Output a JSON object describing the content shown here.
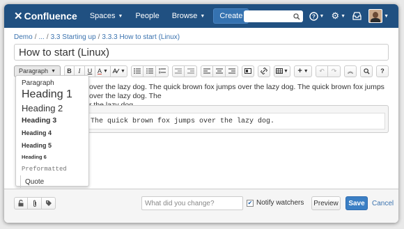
{
  "nav": {
    "logo": "Confluence",
    "spaces": "Spaces",
    "people": "People",
    "browse": "Browse",
    "create": "Create"
  },
  "breadcrumb": [
    "Demo",
    "...",
    "3.3 Starting up",
    "3.3.3 How to start (Linux)"
  ],
  "page_title": "How to start (Linux)",
  "toolbar": {
    "paragraph": "Paragraph",
    "bold": "B",
    "italic": "I",
    "underline": "U",
    "color": "A"
  },
  "content": {
    "line1": "over the lazy dog. The quick brown fox jumps over the lazy dog. The quick brown fox jumps over the lazy dog. The",
    "line2": "r the lazy dog.",
    "code": "The quick brown fox jumps over the lazy dog."
  },
  "dropdown": {
    "paragraph": "Paragraph",
    "h1": "Heading 1",
    "h2": "Heading 2",
    "h3": "Heading 3",
    "h4": "Heading 4",
    "h5": "Heading 5",
    "h6": "Heading 6",
    "preformatted": "Preformatted",
    "quote": "Quote"
  },
  "bottom": {
    "change_placeholder": "What did you change?",
    "notify": "Notify watchers",
    "preview": "Preview",
    "save": "Save",
    "cancel": "Cancel"
  },
  "colors": {
    "nav_bg": "#205081",
    "accent": "#3b7fc4"
  }
}
